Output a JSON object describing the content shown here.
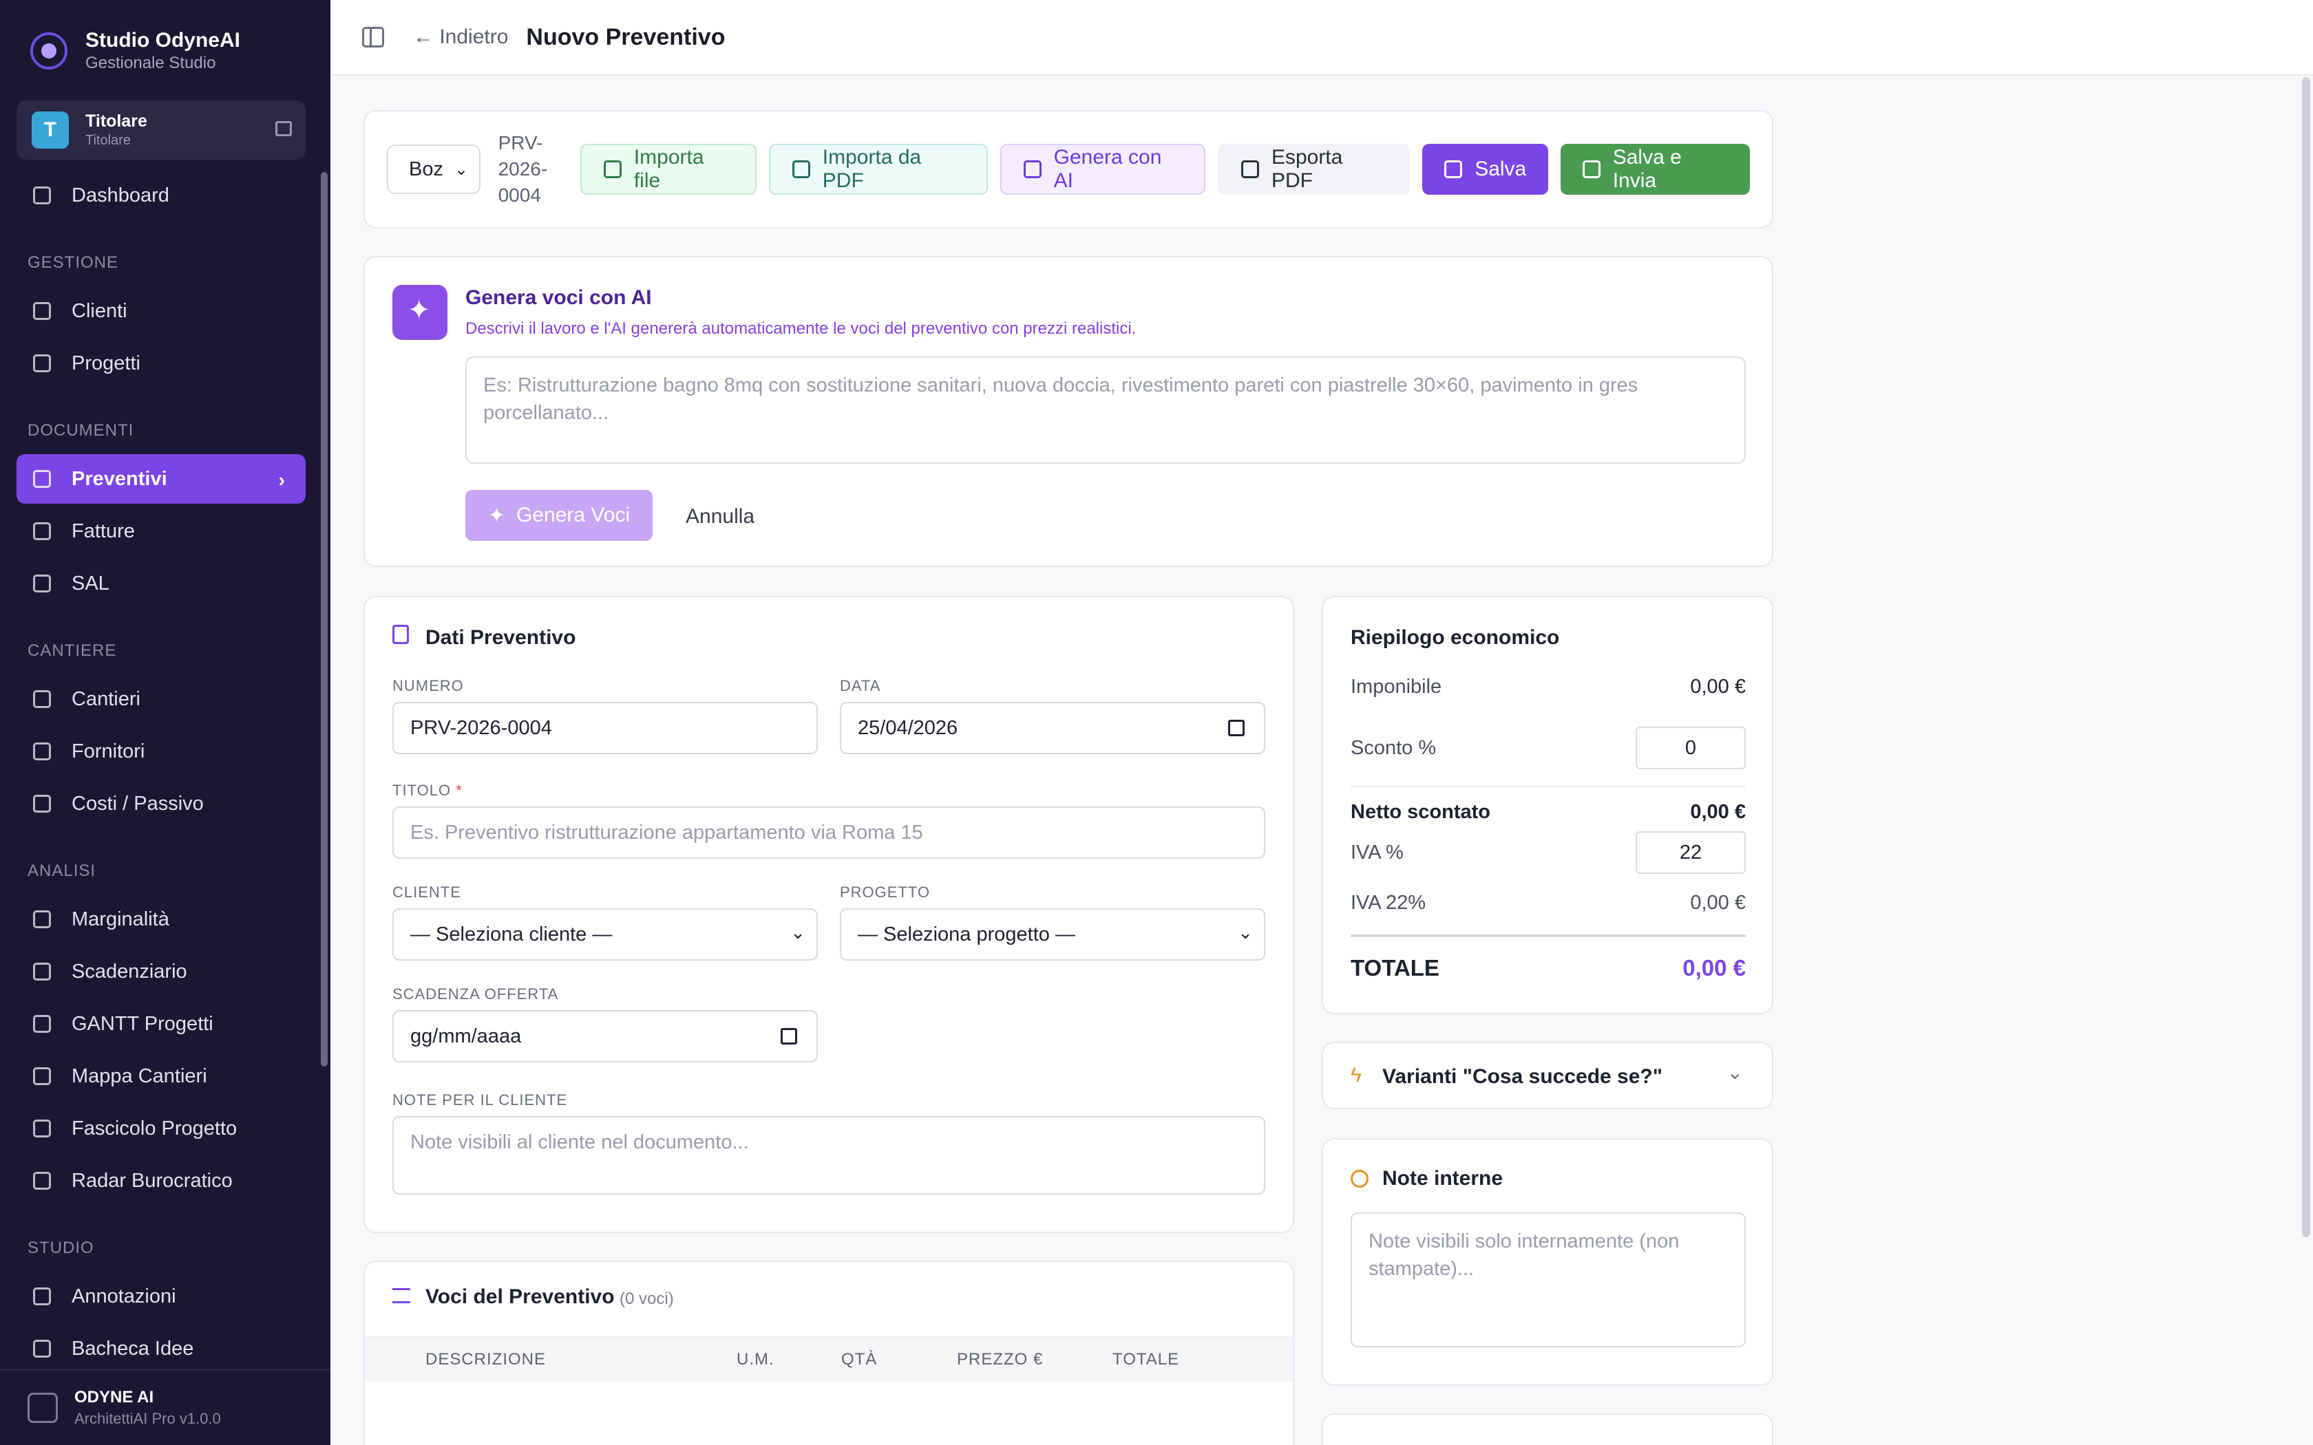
{
  "brand": {
    "name": "Studio OdyneAI",
    "subtitle": "Gestionale Studio"
  },
  "user": {
    "initial": "T",
    "name": "Titolare",
    "role": "Titolare"
  },
  "nav": {
    "dashboard": "Dashboard",
    "sections": {
      "gestione": "GESTIONE",
      "documenti": "DOCUMENTI",
      "cantiere": "CANTIERE",
      "analisi": "ANALISI",
      "studio": "STUDIO"
    },
    "clienti": "Clienti",
    "progetti": "Progetti",
    "preventivi": "Preventivi",
    "fatture": "Fatture",
    "sal": "SAL",
    "cantieri": "Cantieri",
    "fornitori": "Fornitori",
    "costi": "Costi / Passivo",
    "marginalita": "Marginalità",
    "scadenziario": "Scadenziario",
    "gantt": "GANTT Progetti",
    "mappa": "Mappa Cantieri",
    "fascicolo": "Fascicolo Progetto",
    "radar": "Radar Burocratico",
    "annotazioni": "Annotazioni",
    "bacheca": "Bacheca Idee"
  },
  "footer": {
    "name": "ODYNE AI",
    "version": "ArchitettiAI Pro v1.0.0"
  },
  "topbar": {
    "back": "← Indietro",
    "title": "Nuovo Preventivo"
  },
  "toolbar": {
    "status": "Boz",
    "code": "PRV-2026-0004",
    "importa_file": "Importa file",
    "importa_pdf": "Importa da PDF",
    "genera_ai": "Genera con AI",
    "esporta_pdf": "Esporta PDF",
    "salva": "Salva",
    "salva_invia": "Salva e Invia"
  },
  "ai": {
    "title": "Genera voci con AI",
    "subtitle": "Descrivi il lavoro e l'AI genererà automaticamente le voci del preventivo con prezzi realistici.",
    "placeholder": "Es: Ristrutturazione bagno 8mq con sostituzione sanitari, nuova doccia, rivestimento pareti con piastrelle 30×60, pavimento in gres porcellanato...",
    "generate": "Genera Voci",
    "cancel": "Annulla"
  },
  "dati": {
    "title": "Dati Preventivo",
    "numero_label": "NUMERO",
    "numero": "PRV-2026-0004",
    "data_label": "DATA",
    "data": "25/04/2026",
    "titolo_label": "TITOLO",
    "titolo_req": "*",
    "titolo_ph": "Es. Preventivo ristrutturazione appartamento via Roma 15",
    "cliente_label": "CLIENTE",
    "cliente": "— Seleziona cliente —",
    "progetto_label": "PROGETTO",
    "progetto": "— Seleziona progetto —",
    "scadenza_label": "SCADENZA OFFERTA",
    "scadenza": "gg/mm/aaaa",
    "note_label": "NOTE PER IL CLIENTE",
    "note_ph": "Note visibili al cliente nel documento..."
  },
  "voci": {
    "title": "Voci del Preventivo",
    "count": "(0 voci)",
    "cols": {
      "descrizione": "DESCRIZIONE",
      "um": "U.M.",
      "qta": "QTÀ",
      "prezzo": "PREZZO €",
      "totale": "TOTALE"
    }
  },
  "riepilogo": {
    "title": "Riepilogo economico",
    "imponibile_label": "Imponibile",
    "imponibile": "0,00 €",
    "sconto_label": "Sconto %",
    "sconto": "0",
    "netto_label": "Netto scontato",
    "netto": "0,00 €",
    "iva_pct_label": "IVA %",
    "iva_pct": "22",
    "iva_label": "IVA 22%",
    "iva": "0,00 €",
    "totale_label": "TOTALE",
    "totale": "0,00 €"
  },
  "varianti": {
    "title": "Varianti \"Cosa succede se?\""
  },
  "note_interne": {
    "title": "Note interne",
    "placeholder": "Note visibili solo internamente (non stampate)..."
  },
  "colors": {
    "sidebar": "#1a1733",
    "accent": "#7b45e6",
    "success": "#4a9b51"
  }
}
